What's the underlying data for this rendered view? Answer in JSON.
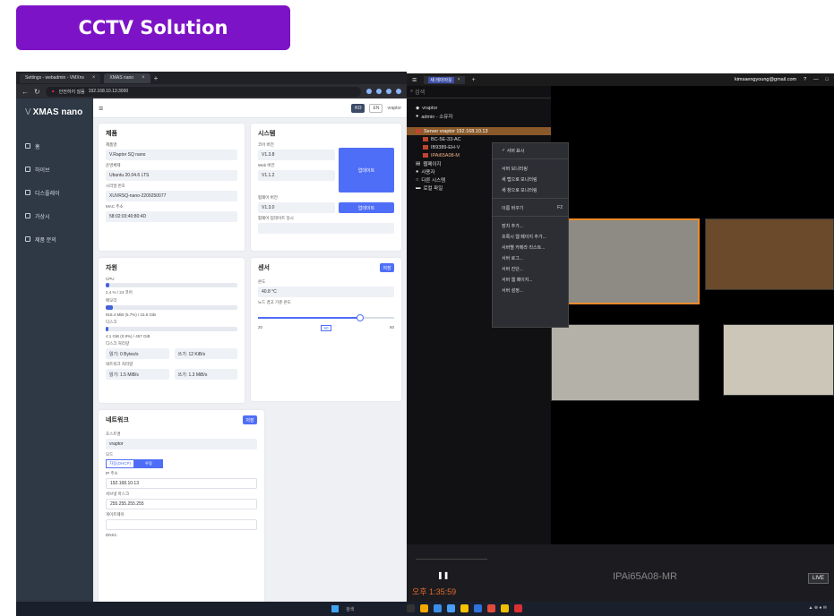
{
  "badge": "CCTV Solution",
  "browser": {
    "tabs": [
      {
        "label": "Settings - webadmin - VMXns",
        "active": false
      },
      {
        "label": "XMAS nano",
        "active": true
      }
    ],
    "url_warning": "안전하지 않음",
    "url": "192.168.10.13:3000"
  },
  "webapp": {
    "logo": "XMAS nano",
    "nav": [
      "홈",
      "하이브",
      "디스플레이",
      "가상시",
      "제품 문의"
    ],
    "top": {
      "lang_ko": "KO",
      "lang_en": "EN",
      "user": "vraptor"
    },
    "product": {
      "title": "제품",
      "model_label": "제품명",
      "model": "V.Raptor SQ nano",
      "os_label": "운영체제",
      "os": "Ubuntu 20.04.6 LTS",
      "serial_label": "시리얼 번호",
      "serial": "XUVRSQ-nano-2209250077",
      "mac_label": "MAC 주소",
      "mac": "58:02:03:40:80:4D"
    },
    "system": {
      "title": "시스템",
      "core_label": "코어 버전",
      "core": "V1.3.8",
      "web_label": "Web 버전",
      "web": "V1.1.2",
      "fw_label": "펌웨어 버전",
      "fw": "V1.3.0",
      "fw_update_label": "펌웨어 업데이트 일시",
      "update_button": "업데이트",
      "update_button2": "업데이트"
    },
    "resources": {
      "title": "자원",
      "cpu_label": "CPU",
      "cpu_value": "2.4 % / 24 코어",
      "cpu_pct": 0.024,
      "mem_label": "메모리",
      "mem_value": "918.4 MiB (5.7%) / 15.6 GiB",
      "mem_pct": 0.057,
      "disk_label": "디스크",
      "disk_value": "4.1 GiB (0.9%) / 457 GiB",
      "disk_pct": 0.009,
      "disk_io_label": "디스크 처리량",
      "disk_read": "읽기: 0 Bytes/s",
      "disk_write": "쓰기: 12 KiB/s",
      "net_io_label": "네트워크 처리량",
      "net_read": "읽기: 1.5 MiB/s",
      "net_write": "쓰기: 1.3 MiB/s"
    },
    "sensor": {
      "title": "센서",
      "button": "저장",
      "temp_label": "온도",
      "temp": "40.8 °C",
      "fan_label": "노드 경고 기준 온도",
      "slider_min": "20",
      "slider_max": "60",
      "slider_value": "50",
      "slider_pct": 0.75
    },
    "network": {
      "title": "네트워크",
      "button": "저장",
      "host_label": "호스트명",
      "host": "vraptor",
      "mode_label": "모드",
      "mode_dhcp": "자동(DHCP)",
      "mode_manual": "수동",
      "ip_label": "IP 주소",
      "ip": "192.168.10.13",
      "mask_label": "서브넷 마스크",
      "mask": "255.255.255.255",
      "gw_label": "게이트웨이",
      "dns_label": "DNS1:"
    }
  },
  "vms": {
    "tab": "새 레이아웃",
    "account": "kimsaengyoung@gmail.com",
    "search_placeholder": "검색",
    "user_name": "vraptor",
    "user_role": "admin - 소유자",
    "server": "Server vraptor 192.168.10.13",
    "cameras": [
      "BC-5E-33-AC",
      "IB9389-EH-V",
      "IPAi65A08-M"
    ],
    "groups": [
      "웹페이지",
      "사용자",
      "다른 시스템",
      "로컬 파일"
    ],
    "context_menu": {
      "top": "서버 표시",
      "group1": [
        "서버 모니터링",
        "새 탭으로 모니터링",
        "새 창으로 모니터링"
      ],
      "rename": "이름 바꾸기",
      "rename_key": "F2",
      "group2": [
        "장치 추가...",
        "프록시 웹 페이지 추가...",
        "서버별 카메라 리스트...",
        "서버 로그...",
        "서버 진단...",
        "서버 웹 페이지...",
        "서버 설정..."
      ]
    },
    "camera_name": "IPAi65A08-MR",
    "time": "오후 1:35:59",
    "live": "LIVE"
  },
  "taskbar": {
    "search": "검색"
  },
  "colors": {
    "badge": "#7d13c6",
    "accent": "#4f6ef7",
    "selection": "#f08a2a"
  }
}
